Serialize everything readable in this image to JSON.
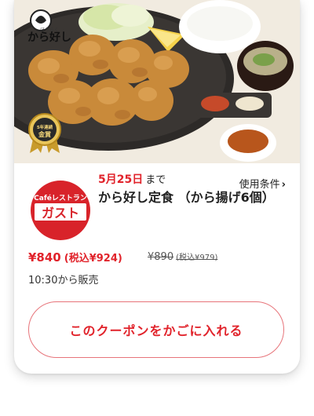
{
  "coupon": {
    "date": "5月25日",
    "date_suffix": "まで",
    "conditions_label": "使用条件",
    "title": "から好し定食 （から揚げ6個）",
    "price": "¥840",
    "price_tax": "(税込¥924)",
    "old_price": "¥890",
    "old_price_tax": "(税込¥979)",
    "sale_time": "10:30から販売",
    "add_button_label": "このクーポンをかごに入れる"
  },
  "brand_logo": {
    "name": "から好し",
    "tagline": "ほうらく"
  },
  "award": {
    "line1": "5年連続",
    "line2": "金賞"
  },
  "gusto_logo": {
    "top": "Caféレストラン",
    "main": "ガスト"
  },
  "colors": {
    "accent": "#e1232b",
    "button_border": "#e7747a",
    "gusto_red": "#d8232a"
  }
}
